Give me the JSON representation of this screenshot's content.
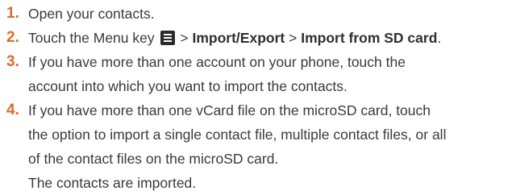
{
  "steps": [
    {
      "number": "1.",
      "text": "Open your contacts."
    },
    {
      "number": "2.",
      "prefix": "Touch the Menu key",
      "sep1": ">",
      "bold1": "Import/Export",
      "sep2": ">",
      "bold2": "Import from SD card",
      "suffix": ".",
      "icon": "menu-key-icon"
    },
    {
      "number": "3.",
      "lines": [
        "If you have more than one account on your phone, touch the",
        "account into which you want to import the contacts."
      ]
    },
    {
      "number": "4.",
      "lines": [
        "If you have more than one vCard file on the microSD card, touch",
        "the option to import a single contact file, multiple contact files, or all",
        "of the contact files on the microSD card."
      ]
    }
  ],
  "result": "The contacts are imported.",
  "colors": {
    "number": "#e3672a",
    "text": "#3a3a3a"
  }
}
